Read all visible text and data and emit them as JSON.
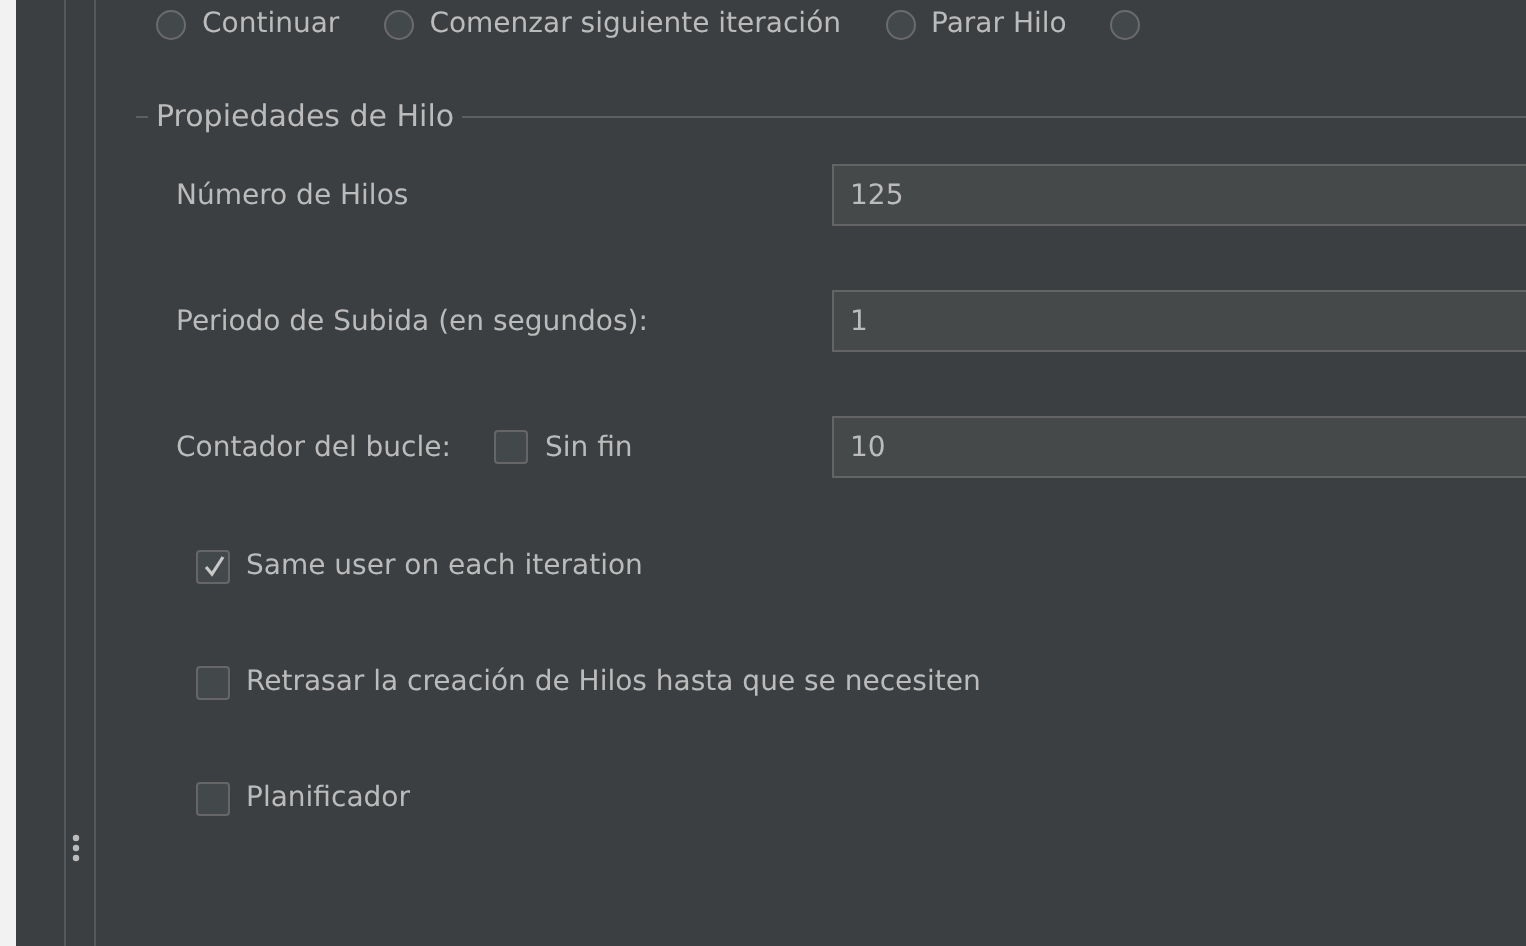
{
  "error_actions": [
    {
      "label": "Continuar",
      "selected": false
    },
    {
      "label": "Comenzar siguiente iteración",
      "selected": false
    },
    {
      "label": "Parar Hilo",
      "selected": false
    },
    {
      "selected": false
    }
  ],
  "thread_properties": {
    "title": "Propiedades de Hilo",
    "fields": [
      {
        "label": "Número de Hilos",
        "value": "125"
      },
      {
        "label": "Periodo de Subida (en segundos):",
        "value": "1"
      },
      {
        "label": "Contador del bucle:",
        "value": "10",
        "checkbox": {
          "label": "Sin fin",
          "checked": false
        }
      }
    ],
    "options": [
      {
        "label": "Same user on each iteration",
        "checked": true
      },
      {
        "label": "Retrasar la creación de Hilos hasta que se necesiten",
        "checked": false
      },
      {
        "label": "Planificador",
        "checked": false
      }
    ]
  }
}
